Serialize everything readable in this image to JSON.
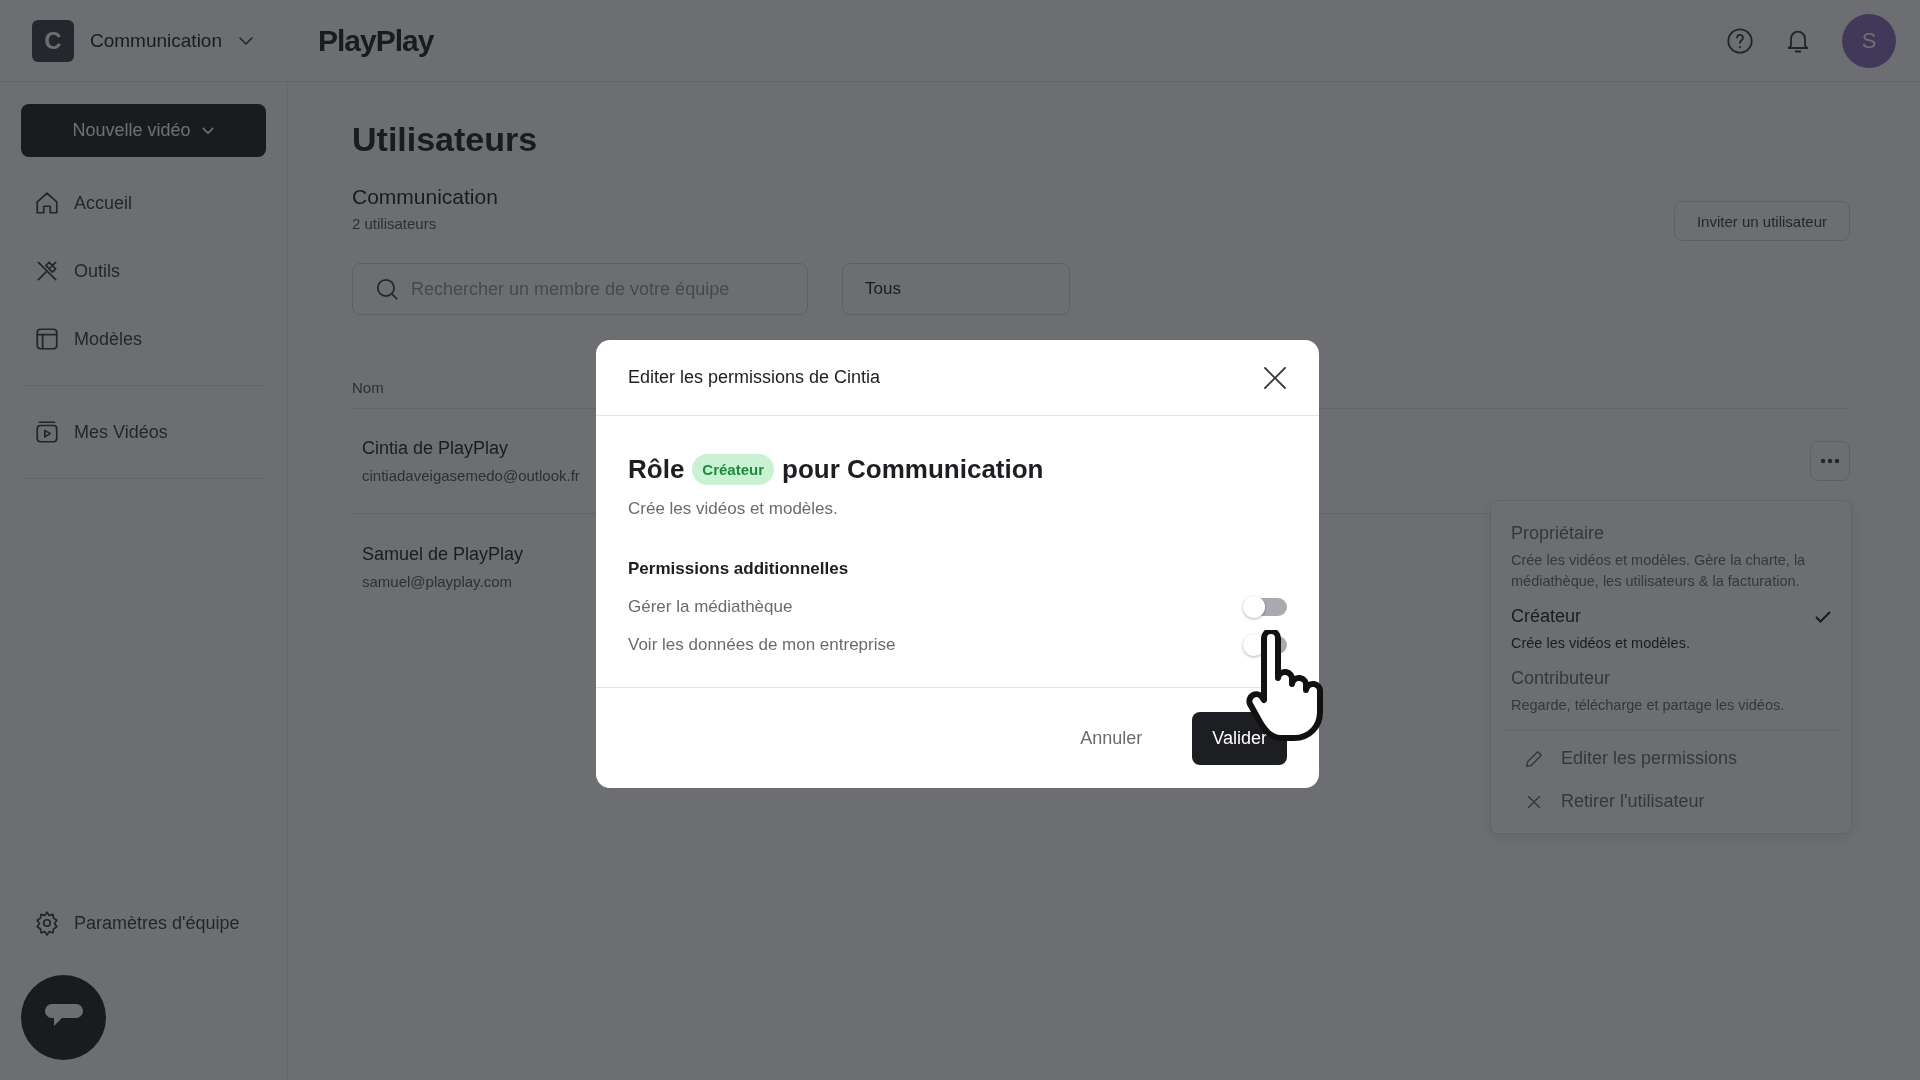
{
  "workspace": {
    "initial": "C",
    "name": "Communication"
  },
  "logo": "PlayPlay",
  "header": {
    "avatar": "S"
  },
  "sidebar": {
    "new_button": "Nouvelle vidéo",
    "sections": [
      [
        {
          "label": "Accueil",
          "kind": "home"
        },
        {
          "label": "Outils",
          "kind": "tools"
        },
        {
          "label": "Modèles",
          "kind": "templates"
        }
      ],
      [
        {
          "label": "Mes Vidéos",
          "kind": "videos"
        }
      ]
    ],
    "footer_item": "Paramètres d'équipe"
  },
  "page": {
    "title": "Utilisateurs",
    "team": "Communication",
    "count": "2 utilisateurs",
    "invite_button": "Inviter un utilisateur",
    "search": {
      "placeholder": "Rechercher un membre de votre équipe"
    },
    "filter": "Tous",
    "table": {
      "columns": [
        "Nom"
      ],
      "rows": [
        {
          "name": "Cintia de PlayPlay",
          "email": "cintiadaveigasemedo@outlook.fr"
        },
        {
          "name": "Samuel de PlayPlay",
          "email": "samuel@playplay.com"
        }
      ]
    }
  },
  "role_menu": {
    "options": [
      {
        "name": "Propriétaire",
        "description": "Crée les vidéos et modèles. Gère la charte, la médiathèque, les utilisateurs & la facturation.",
        "selected": false
      },
      {
        "name": "Créateur",
        "description": "Crée les vidéos et modèles.",
        "selected": true
      },
      {
        "name": "Contributeur",
        "description": "Regarde, télécharge et partage les vidéos.",
        "selected": false
      }
    ],
    "actions": [
      {
        "label": "Editer les permissions",
        "kind": "edit"
      },
      {
        "label": "Retirer l'utilisateur",
        "kind": "remove"
      }
    ]
  },
  "modal": {
    "title": "Editer les permissions de Cintia",
    "role_prefix": "Rôle",
    "role_badge": "Créateur",
    "role_suffix": "pour Communication",
    "role_description": "Crée les vidéos et modèles.",
    "section_title": "Permissions additionnelles",
    "toggles": [
      {
        "label": "Gérer la médiathèque",
        "on": false
      },
      {
        "label": "Voir les données de mon entreprise",
        "on": false
      }
    ],
    "cancel_button": "Annuler",
    "confirm_button": "Valider"
  }
}
